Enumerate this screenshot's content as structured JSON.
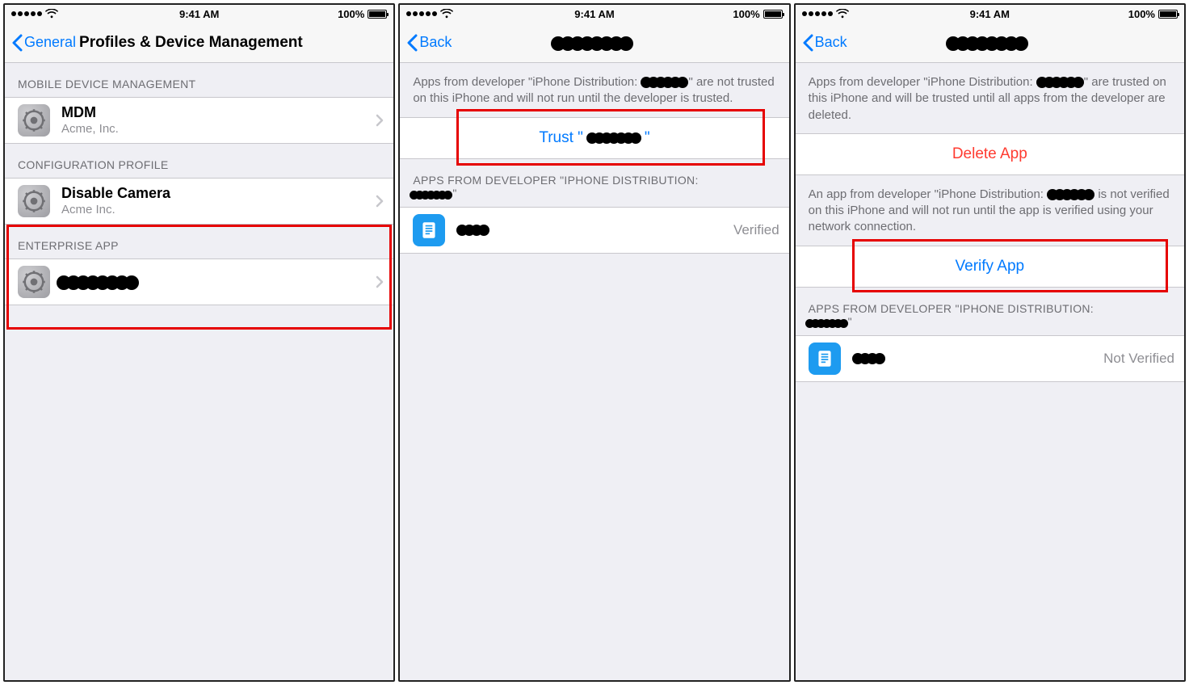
{
  "status": {
    "time": "9:41 AM",
    "battery_pct": "100%"
  },
  "screen1": {
    "nav_back_label": "General",
    "nav_title": "Profiles & Device Management",
    "sections": {
      "mdm_header": "MOBILE DEVICE MANAGEMENT",
      "mdm_item": {
        "title": "MDM",
        "sub": "Acme, Inc."
      },
      "config_header": "CONFIGURATION PROFILE",
      "config_item": {
        "title": "Disable Camera",
        "sub": "Acme Inc."
      },
      "enterprise_header": "ENTERPRISE APP"
    }
  },
  "screen2": {
    "nav_back_label": "Back",
    "note_prefix": "Apps from developer \"iPhone Distribution:",
    "note_suffix": "\" are not trusted on this iPhone and will not run until the developer is trusted.",
    "trust_prefix": "Trust \"",
    "trust_suffix": "\"",
    "apps_header_prefix": "APPS FROM DEVELOPER \"IPHONE DISTRIBUTION:",
    "apps_header_suffix": "\"",
    "app_status": "Verified"
  },
  "screen3": {
    "nav_back_label": "Back",
    "note1_prefix": "Apps from developer \"iPhone Distribution:",
    "note1_suffix": "\" are trusted on this iPhone and will be trusted until all apps from the developer are deleted.",
    "delete_label": "Delete App",
    "note2_prefix": "An app from developer \"iPhone Distribution:",
    "note2_suffix": "is not verified on this iPhone and will not run until the app is verified using your network connection.",
    "verify_label": "Verify App",
    "apps_header_prefix": "APPS FROM DEVELOPER \"IPHONE DISTRIBUTION:",
    "apps_header_suffix": "\"",
    "app_status": "Not Verified"
  }
}
